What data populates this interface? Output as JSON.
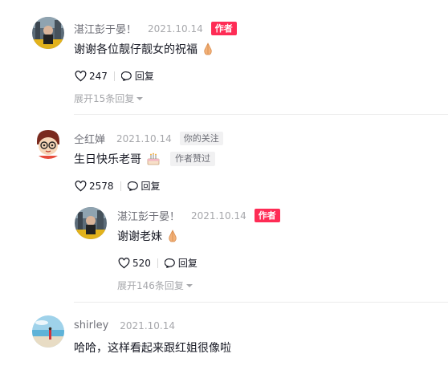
{
  "comments": [
    {
      "username": "湛江彭于晏！",
      "date": "2021.10.14",
      "badge": "作者",
      "text": "谢谢各位靓仔靓女的祝福",
      "emoji": "folded-hands-emoji",
      "likes": "247",
      "reply_label": "回复",
      "expand_label": "展开15条回复",
      "replies": []
    },
    {
      "username": "仝红婵",
      "date": "2021.10.14",
      "badge": "你的关注",
      "text": "生日快乐老哥",
      "emoji": "birthday-cake-emoji",
      "liked_tag": "作者赞过",
      "likes": "2578",
      "reply_label": "回复",
      "replies": [
        {
          "username": "湛江彭于晏！",
          "date": "2021.10.14",
          "badge": "作者",
          "text": "谢谢老妹",
          "emoji": "folded-hands-emoji",
          "likes": "520",
          "reply_label": "回复",
          "expand_label": "展开146条回复"
        }
      ]
    },
    {
      "username": "shirley",
      "date": "2021.10.14",
      "text": "哈哈，这样看起来跟红姐很像啦"
    }
  ],
  "colors": {
    "author_badge": "#fe2c55",
    "muted": "#a6a7ab",
    "text": "#161823"
  }
}
